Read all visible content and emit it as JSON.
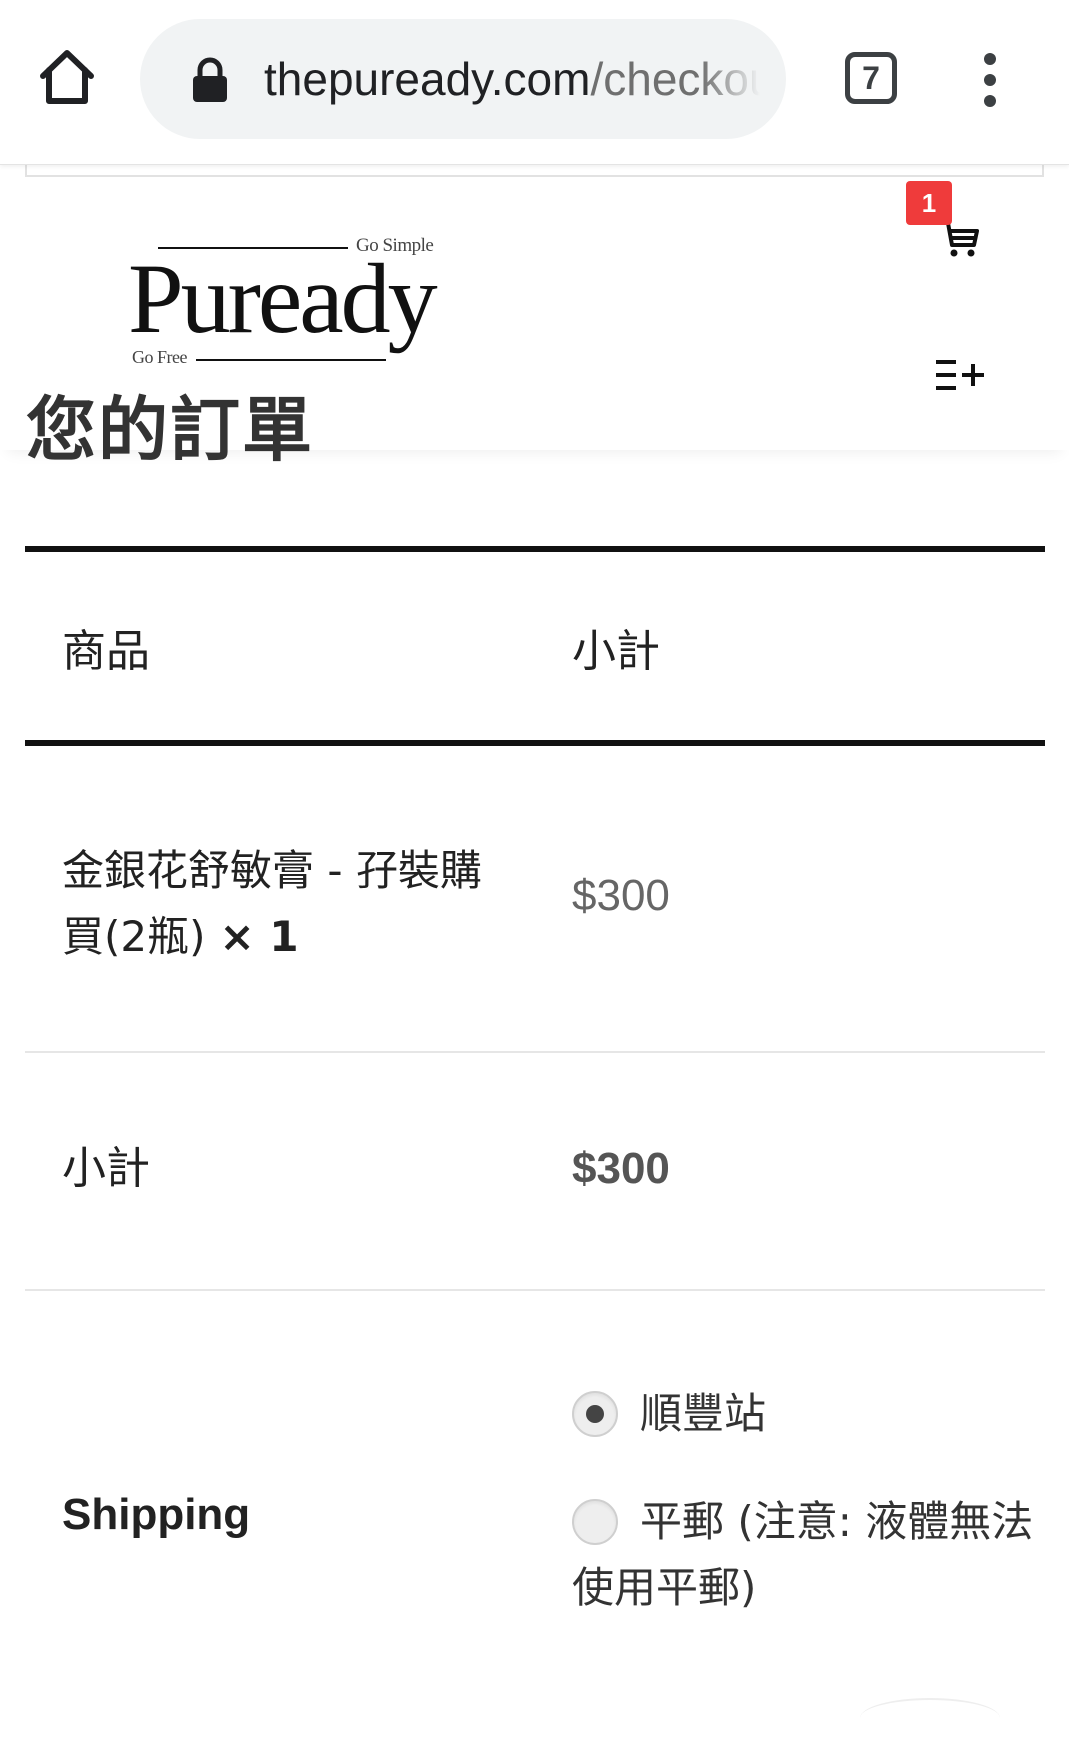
{
  "browser": {
    "url_domain": "thepuready.com",
    "url_path": "/checkout/",
    "tab_count": "7",
    "icons": [
      "home-icon",
      "lock-icon",
      "tabs-icon",
      "kebab-menu-icon"
    ]
  },
  "header": {
    "logo": {
      "word": "Puready",
      "tagline_top": "Go Simple",
      "tagline_bottom": "Go Free"
    },
    "cart_count": "1",
    "icons": [
      "cart-icon",
      "menu-add-icon"
    ]
  },
  "page_title": "您的訂單",
  "order": {
    "columns": {
      "product": "商品",
      "subtotal": "小計"
    },
    "items": [
      {
        "name": "金銀花舒敏膏 - 孖裝購買(2瓶)",
        "qty": "× 1",
        "price": "$300"
      }
    ],
    "subtotal_label": "小計",
    "subtotal_value": "$300",
    "shipping_label": "Shipping",
    "shipping_options": [
      {
        "label": "順豐站",
        "selected": true
      },
      {
        "label": "平郵 (注意: 液體無法使用平郵)",
        "selected": false
      }
    ]
  },
  "colors": {
    "badge": "#ef3b3b",
    "rule": "#111111",
    "url_bg": "#f1f3f4"
  }
}
